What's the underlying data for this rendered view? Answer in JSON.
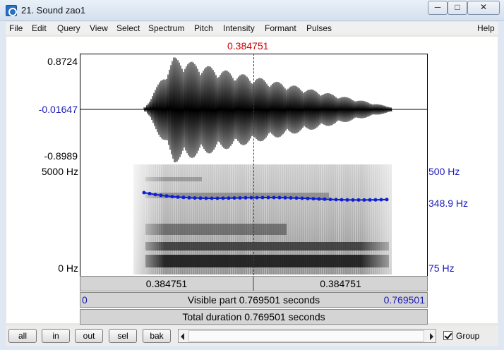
{
  "window": {
    "title": "21. Sound zao1",
    "minimize_glyph": "─",
    "maximize_glyph": "□",
    "close_glyph": "✕"
  },
  "menu": [
    "File",
    "Edit",
    "Query",
    "View",
    "Select",
    "Spectrum",
    "Pitch",
    "Intensity",
    "Formant",
    "Pulses",
    "Help"
  ],
  "cursor": {
    "time_label": "0.384751",
    "color": "#cc0000"
  },
  "waveform": {
    "max_label": "0.8724",
    "zero_label": "-0.01647",
    "min_label": "-0.8989"
  },
  "spectrogram": {
    "top_freq_label": "5000 Hz",
    "bottom_freq_label": "0 Hz",
    "pitch_top_label": "500 Hz",
    "pitch_value_label": "348.9 Hz",
    "pitch_bottom_label": "75 Hz",
    "pitch_color": "#1020d0"
  },
  "time_bars": {
    "left_segment": "0.384751",
    "right_segment": "0.384751",
    "visible_start": "0",
    "visible_text": "Visible part 0.769501 seconds",
    "visible_end": "0.769501",
    "total_text": "Total duration 0.769501 seconds"
  },
  "toolbar": {
    "buttons": [
      "all",
      "in",
      "out",
      "sel",
      "bak"
    ],
    "group_label": "Group",
    "group_checked": true
  }
}
